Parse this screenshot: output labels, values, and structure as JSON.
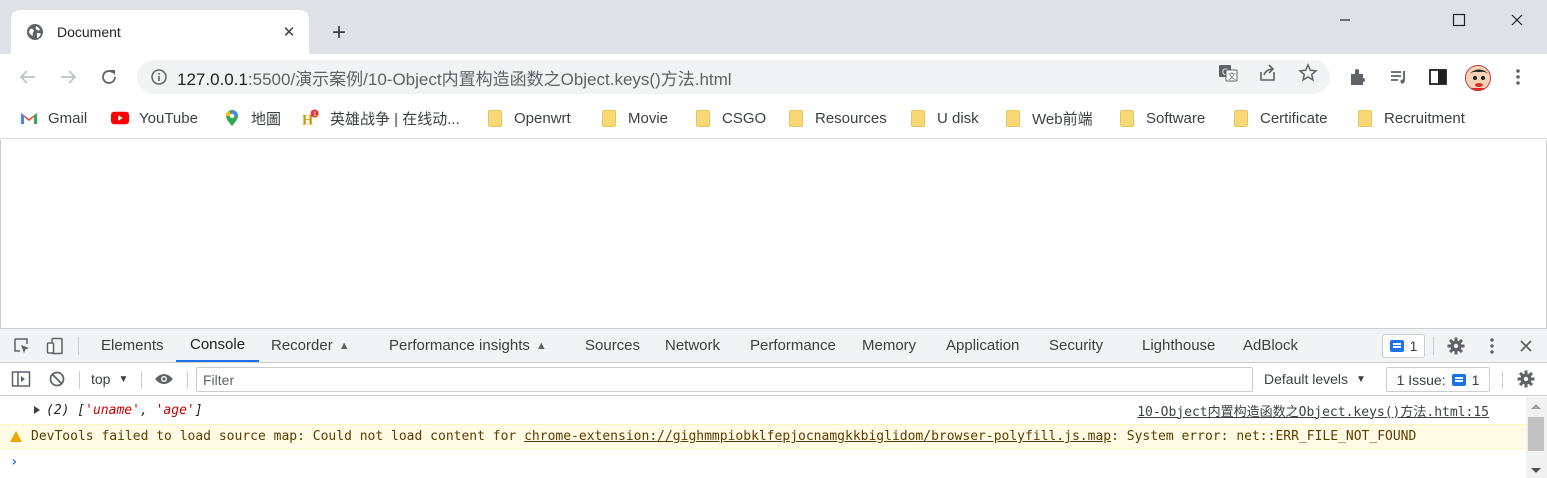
{
  "tab": {
    "title": "Document"
  },
  "omnibox": {
    "host": "127.0.0.1",
    "rest": ":5500/演示案例/10-Object内置构造函数之Object.keys()方法.html"
  },
  "bookmarks": [
    {
      "label": "Gmail",
      "icon": "gmail-icon"
    },
    {
      "label": "YouTube",
      "icon": "youtube-icon"
    },
    {
      "label": "地圖",
      "icon": "maps-icon"
    },
    {
      "label": "英雄战争 | 在线动...",
      "icon": "game-icon"
    },
    {
      "label": "Openwrt",
      "icon": "folder-icon"
    },
    {
      "label": "Movie",
      "icon": "folder-icon"
    },
    {
      "label": "CSGO",
      "icon": "folder-icon"
    },
    {
      "label": "Resources",
      "icon": "folder-icon"
    },
    {
      "label": "U disk",
      "icon": "folder-icon"
    },
    {
      "label": "Web前端",
      "icon": "folder-icon"
    },
    {
      "label": "Software",
      "icon": "folder-icon"
    },
    {
      "label": "Certificate",
      "icon": "folder-icon"
    },
    {
      "label": "Recruitment",
      "icon": "folder-icon"
    }
  ],
  "devtools": {
    "tabs": [
      "Elements",
      "Console",
      "Recorder",
      "Performance insights",
      "Sources",
      "Network",
      "Performance",
      "Memory",
      "Application",
      "Security",
      "Lighthouse",
      "AdBlock"
    ],
    "active_tab": "Console",
    "message_count": "1",
    "toolbar": {
      "context": "top",
      "filter_placeholder": "Filter",
      "levels": "Default levels",
      "issues_label": "1 Issue:",
      "issues_count": "1"
    },
    "console": {
      "log_prefix": "(2) [",
      "log_item1": "'uname'",
      "log_sep": ", ",
      "log_item2": "'age'",
      "log_suffix": "]",
      "log_source": "10-Object内置构造函数之Object.keys()方法.html:15",
      "warn_prefix": "DevTools failed to load source map: Could not load content for ",
      "warn_link": "chrome-extension://gighmmpiobklfepjocnamgkkbiglidom/browser-polyfill.js.map",
      "warn_suffix": ": System error: net::ERR_FILE_NOT_FOUND",
      "prompt": "›"
    }
  },
  "colors": {
    "accent": "#1a73e8",
    "warning_bg": "#fffbe5",
    "tabstrip": "#dee1e6"
  }
}
